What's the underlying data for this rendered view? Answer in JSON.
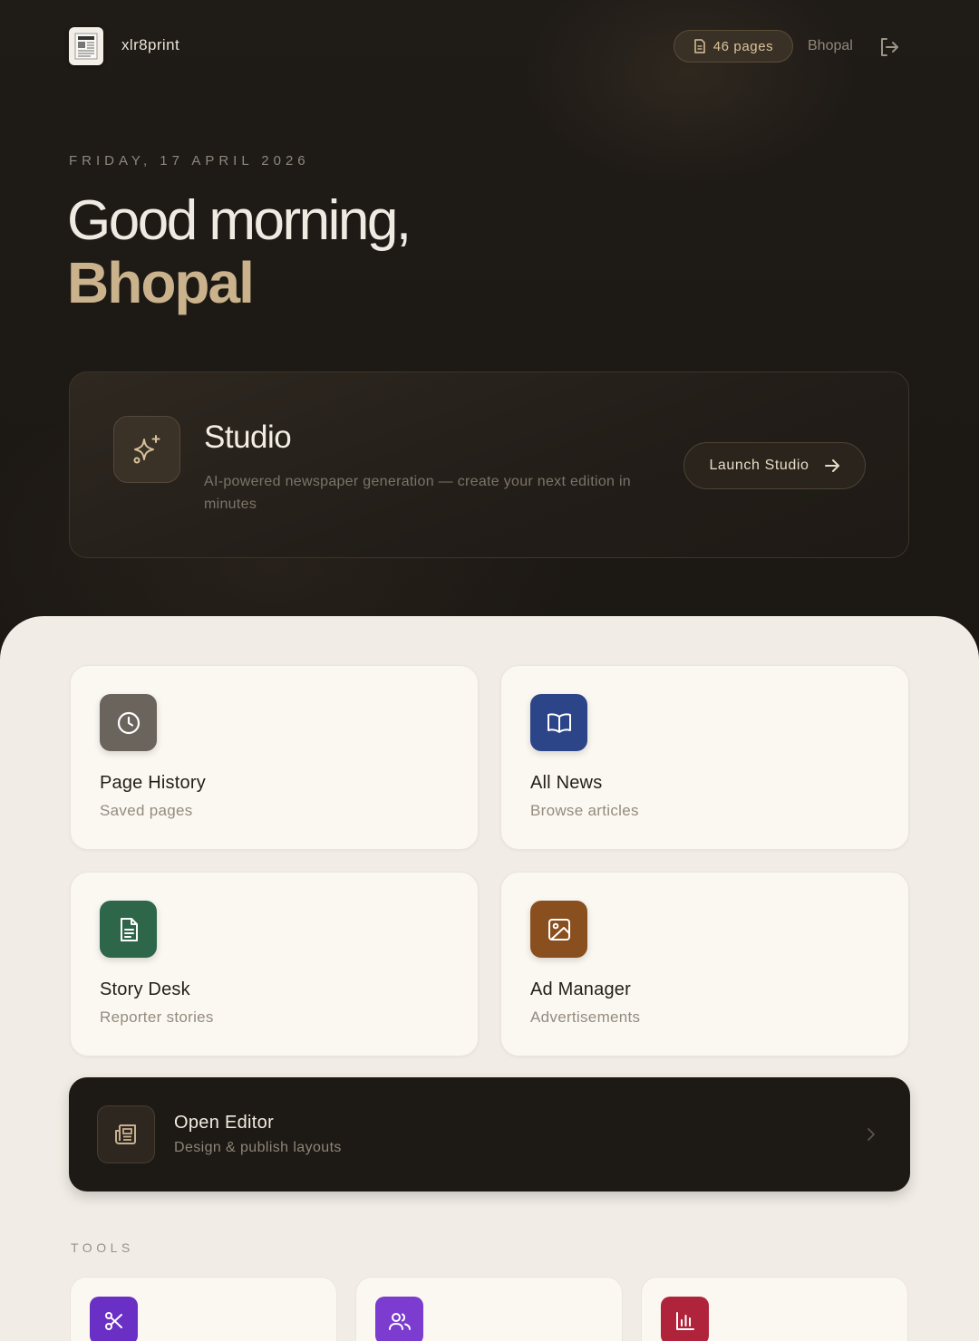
{
  "header": {
    "brand": "xlr8print",
    "pages_badge": "46 pages",
    "city": "Bhopal"
  },
  "hero": {
    "date": "FRIDAY, 17 APRIL 2026",
    "greeting": "Good morning,",
    "name": "Bhopal"
  },
  "studio": {
    "title": "Studio",
    "description": "AI-powered newspaper generation — create your next edition in minutes",
    "button_label": "Launch Studio"
  },
  "cards": [
    {
      "title": "Page History",
      "subtitle": "Saved pages",
      "icon": "clock-icon",
      "color": "#6b645d"
    },
    {
      "title": "All News",
      "subtitle": "Browse articles",
      "icon": "book-open-icon",
      "color": "#2c4488"
    },
    {
      "title": "Story Desk",
      "subtitle": "Reporter stories",
      "icon": "file-text-icon",
      "color": "#2e6649"
    },
    {
      "title": "Ad Manager",
      "subtitle": "Advertisements",
      "icon": "image-icon",
      "color": "#8a4f1f"
    }
  ],
  "editor": {
    "title": "Open Editor",
    "subtitle": "Design & publish layouts"
  },
  "tools": {
    "label": "TOOLS",
    "items": [
      {
        "icon": "scissors-icon",
        "color": "#6a2fc4"
      },
      {
        "icon": "users-icon",
        "color": "#7b3ccf"
      },
      {
        "icon": "bar-chart-icon",
        "color": "#b0243b"
      }
    ]
  },
  "colors": {
    "accent_gold": "#c9b28c",
    "dark_bg": "#1c1814",
    "light_bg": "#f1ede6"
  }
}
